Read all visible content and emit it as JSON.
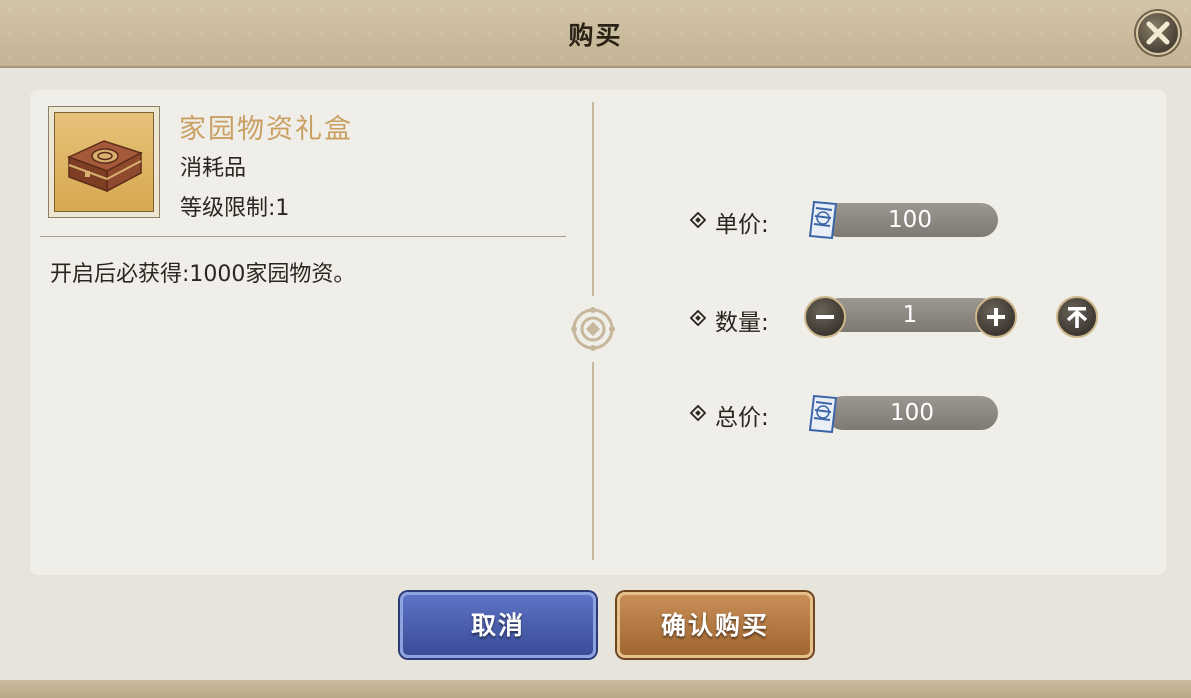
{
  "dialog": {
    "title": "购买"
  },
  "item": {
    "name": "家园物资礼盒",
    "type": "消耗品",
    "level_limit": "等级限制:1",
    "description": "开启后必获得:1000家园物资。"
  },
  "purchase": {
    "unit_price_label": "单价:",
    "unit_price": "100",
    "quantity_label": "数量:",
    "quantity": "1",
    "total_price_label": "总价:",
    "total_price": "100",
    "currency_icon": "coupon-icon"
  },
  "buttons": {
    "cancel": "取消",
    "confirm": "确认购买"
  },
  "colors": {
    "item_name": "#c9a063",
    "cancel_button": "#4a5cb0",
    "confirm_button": "#b57a42"
  }
}
